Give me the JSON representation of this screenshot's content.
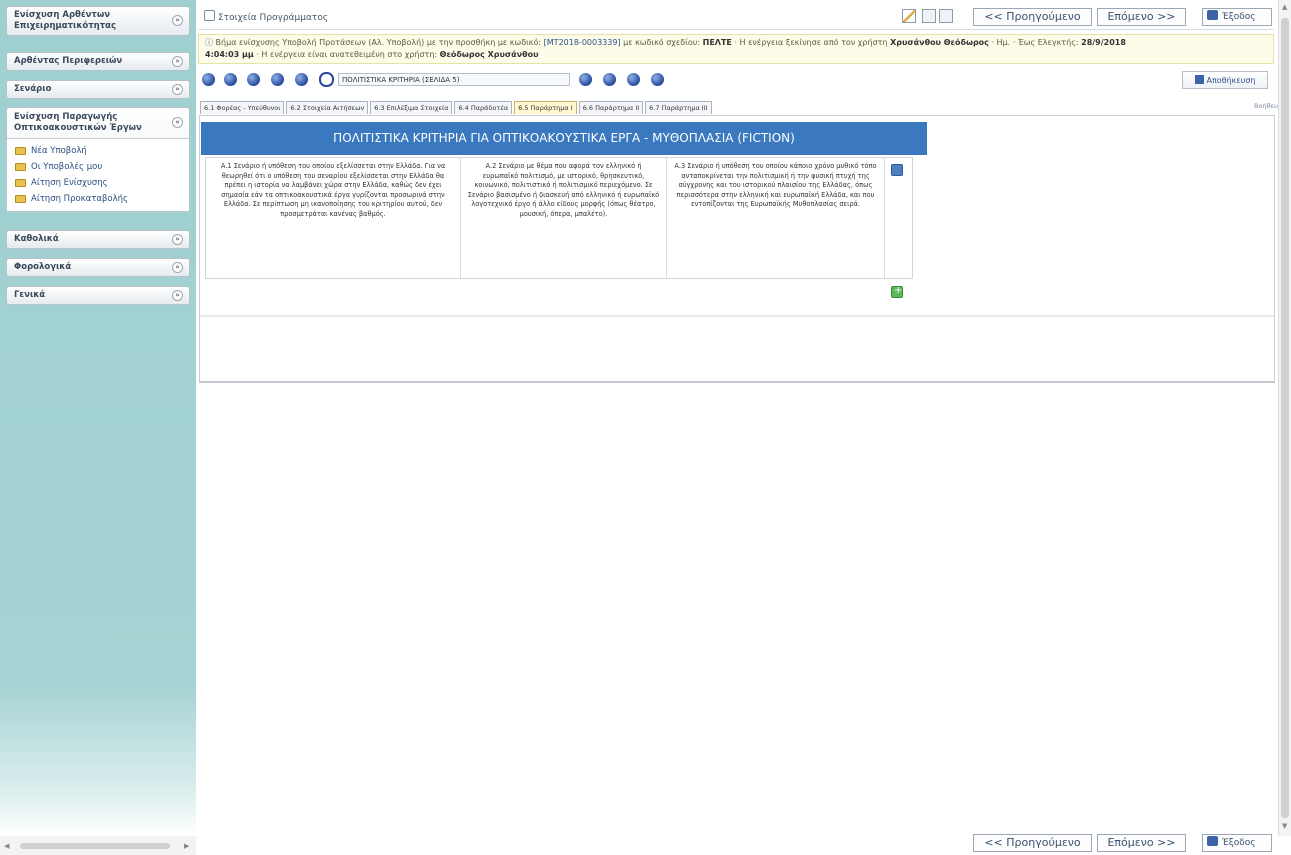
{
  "sidebar": {
    "panels": [
      {
        "label": "Ενίσχυση Αρθέντων Επιχειρηματικότητας"
      },
      {
        "label": "Αρθέντας Περιφερειών"
      },
      {
        "label": "Σενάριο"
      },
      {
        "label": "Ενίσχυση Παραγωγής Οπτικοακουστικών Έργων",
        "items": [
          "Νέα Υποβολή",
          "Οι Υποβολές μου",
          "Αίτηση Ενίσχυσης",
          "Αίτηση Προκαταβολής"
        ]
      },
      {
        "label": "Καθολικά"
      },
      {
        "label": "Φορολογικά"
      },
      {
        "label": "Γενικά"
      }
    ]
  },
  "topbar": {
    "title": "Στοιχεία Προγράμματος",
    "prev_label": "<< Προηγούμενο",
    "next_label": "Επόμενο >>",
    "exit_label": "Έξοδος"
  },
  "info": {
    "line1_a": "Βήμα ενίσχυσης Υποβολή Προτάσεων (Αλ. Υποβολή) με την προσθήκη με κωδικό:",
    "code": "[ΜΤ2018-0003339]",
    "line1_b": "με κωδικό σχεδίου:",
    "project": "ΠΕΛΤΕ",
    "line1_c": "· Η ενέργεια ξεκίνησε από τον χρήστη",
    "user": "Χρυσάνθου Θεόδωρος",
    "line1_d": "· Ημ. · Έως Ελεγκτής:",
    "date": "28/9/2018",
    "line2_a": "4:04:03 μμ",
    "line2_b": "· Η ενέργεια είναι ανατεθειμένη στο χρήστη:",
    "assignee": "Θεόδωρος Χρυσάνθου"
  },
  "steps": {
    "current_label": "ΠΟΛΙΤΙΣΤΙΚΑ ΚΡΙΤΗΡΙΑ (ΣΕΛΙΔΑ 5)",
    "save_label": "Αποθήκευση"
  },
  "tabs": [
    {
      "label": "6.1 Φορέας - Υπεύθυνοι",
      "active": false
    },
    {
      "label": "6.2 Στοιχεία Αιτήσεων",
      "active": false
    },
    {
      "label": "6.3 Επιλέξιμα Στοιχεία",
      "active": false
    },
    {
      "label": "6.4 Παράδοτέα",
      "active": false
    },
    {
      "label": "6.5 Παράρτημα I",
      "active": true
    },
    {
      "label": "6.6 Παράρτημα II",
      "active": false
    },
    {
      "label": "6.7 Παράρτημα III",
      "active": false
    }
  ],
  "help_label": "Βοήθεια",
  "section": {
    "title": "ΠΟΛΙΤΙΣΤΙΚΑ ΚΡΙΤΗΡΙΑ ΓΙΑ ΟΠΤΙΚΟΑΚΟΥΣΤΙΚΑ ΕΡΓΑ - ΜΥΘΟΠΛΑΣΙΑ (FICTION)",
    "criteria": [
      "Α.1 Σενάριο ή υπόθεση του οποίου εξελίσσεται στην Ελλάδα. Για να θεωρηθεί ότι ο υπόθεση του σεναρίου εξελίσσεται στην Ελλάδα θα πρέπει η ιστορία να λαμβάνει χώρα στην Ελλάδα, καθώς δεν έχει σημασία εάν τα οπτικοακουστικά έργα γυρίζονται προσωρινά στην Ελλάδα. Σε περίπτωση μη ικανοποίησης του κριτηρίου αυτού, δεν προσμετράται κανένας βαθμός.",
      "Α.2 Σενάριο με θέμα που αφορά τον ελληνικό ή ευρωπαϊκό πολιτισμό, με ιστορικό, θρησκευτικό, κοινωνικό, πολιτιστικό ή πολιτισμικό περιεχόμενο. Σε Σενάριο βασισμένο ή διασκευή από ελληνικό ή ευρωπαϊκό λογοτεχνικό έργο ή άλλο είδους μορφής (όπως θέατρο, μουσική, όπερα, μπαλέτο).",
      "Α.3 Σενάριο ή υπόθεση του οποίου κάποιο χρόνο μυθικό τόπο ανταποκρίνεται την πολιτισμική ή την φυσική πτυχή της σύγχρονης και του ιστορικού πλαισίου της Ελλάδας, όπως περισσότερα στην ελληνική και ευρωπαϊκή Ελλάδα, και που εντοπίζονται της Ευρωπαϊκής Μυθοπλασίας σειρά."
    ]
  }
}
